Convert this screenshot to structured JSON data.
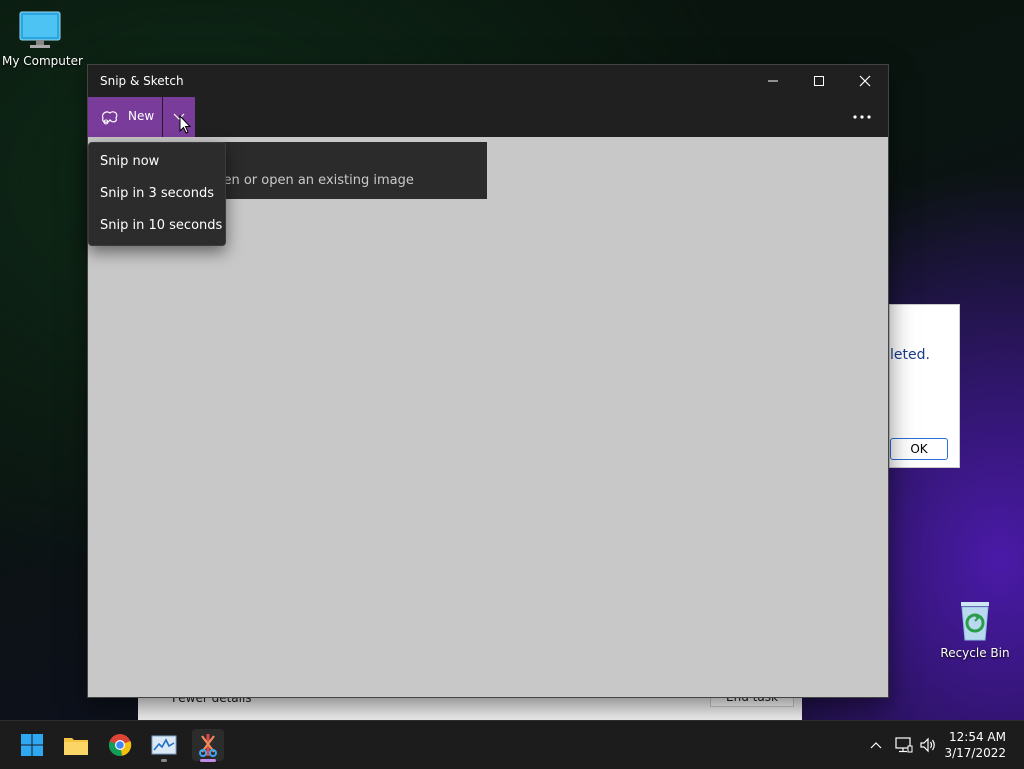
{
  "desktop": {
    "icons": [
      {
        "label": "My Computer"
      },
      {
        "label": "Recycle Bin"
      }
    ]
  },
  "background_dialog": {
    "message_fragment": "leted.",
    "ok_label": "OK"
  },
  "task_manager": {
    "fewer_details": "Fewer details",
    "end_task": "End task"
  },
  "snip_window": {
    "title": "Snip & Sketch",
    "new_label": "New",
    "hint_text": "r screen or open an existing image",
    "menu_items": [
      {
        "label": "Snip now"
      },
      {
        "label": "Snip in 3 seconds"
      },
      {
        "label": "Snip in 10 seconds"
      }
    ],
    "accent_color": "#7a3c9a"
  },
  "taskbar": {
    "time": "12:54 AM",
    "date": "3/17/2022",
    "apps": [
      "start-icon",
      "file-explorer-icon",
      "chrome-icon",
      "task-manager-icon",
      "snip-sketch-icon"
    ]
  }
}
